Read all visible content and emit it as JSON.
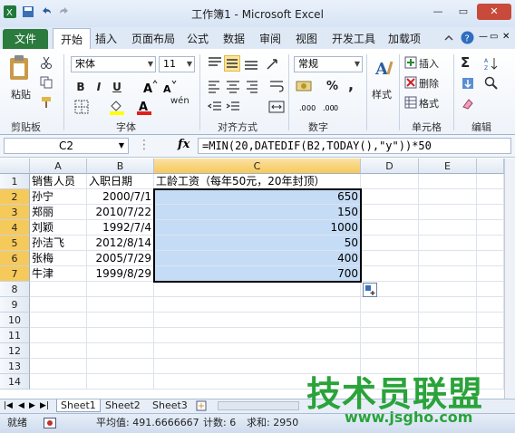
{
  "window": {
    "title": "工作簿1 - Microsoft Excel"
  },
  "ribbon_tabs": [
    "文件",
    "开始",
    "插入",
    "页面布局",
    "公式",
    "数据",
    "审阅",
    "视图",
    "开发工具",
    "加载项"
  ],
  "ribbon": {
    "paste_label": "粘贴",
    "font_name": "宋体",
    "font_size": "11",
    "number_format": "常规",
    "style_label": "样式",
    "insert_label": "插入",
    "delete_label": "删除",
    "format_label": "格式",
    "groups": [
      "剪贴板",
      "字体",
      "对齐方式",
      "数字",
      "单元格",
      "编辑"
    ],
    "bold": "B",
    "italic": "I",
    "underline": "U",
    "percent": "%",
    "comma": ",",
    "sigma": "Σ",
    "fx": "fx",
    "wen": "wén"
  },
  "formula_bar": {
    "name_box": "C2",
    "formula": "=MIN(20,DATEDIF(B2,TODAY(),\"y\"))*50"
  },
  "grid": {
    "columns": [
      "A",
      "B",
      "C",
      "D",
      "E"
    ],
    "rows": [
      "1",
      "2",
      "3",
      "4",
      "5",
      "6",
      "7",
      "8",
      "9",
      "10",
      "11",
      "12",
      "13",
      "14"
    ],
    "headers": [
      "销售人员",
      "入职日期",
      "工龄工资（每年50元，20年封顶）"
    ],
    "data": [
      [
        "孙宁",
        "2000/7/1",
        "650"
      ],
      [
        "郑丽",
        "2010/7/22",
        "150"
      ],
      [
        "刘颖",
        "1992/7/4",
        "1000"
      ],
      [
        "孙洁飞",
        "2012/8/14",
        "50"
      ],
      [
        "张梅",
        "2005/7/29",
        "400"
      ],
      [
        "牛津",
        "1999/8/29",
        "700"
      ]
    ]
  },
  "sheets": [
    "Sheet1",
    "Sheet2",
    "Sheet3"
  ],
  "status": {
    "mode": "就绪",
    "average": "平均值: 491.6666667",
    "count": "计数: 6",
    "sum": "求和: 2950"
  },
  "watermark": {
    "text": "技术员联盟",
    "url": "www.jsgho.com"
  },
  "colors": {
    "file_tab": "#2b7a3e",
    "selection": "#c5dcf6",
    "header_highlight": "#f6c95b"
  }
}
